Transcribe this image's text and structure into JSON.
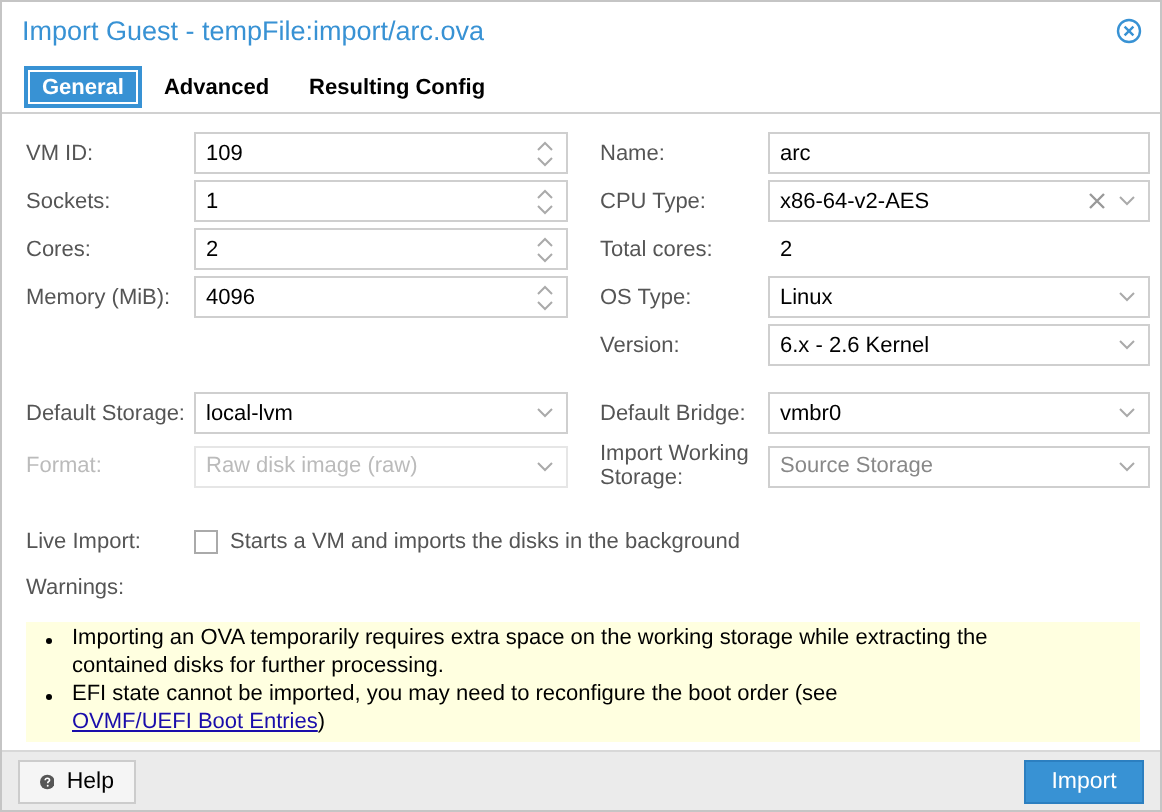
{
  "window": {
    "title": "Import Guest - tempFile:import/arc.ova"
  },
  "tabs": [
    {
      "label": "General",
      "selected": true
    },
    {
      "label": "Advanced",
      "selected": false
    },
    {
      "label": "Resulting Config",
      "selected": false
    }
  ],
  "top_left": [
    {
      "label": "VM ID:",
      "kind": "spinner",
      "value": "109",
      "disabled": false
    },
    {
      "label": "Sockets:",
      "kind": "spinner",
      "value": "1",
      "disabled": false
    },
    {
      "label": "Cores:",
      "kind": "spinner",
      "value": "2",
      "disabled": false
    },
    {
      "label": "Memory (MiB):",
      "kind": "spinner",
      "value": "4096",
      "disabled": false
    }
  ],
  "top_right": [
    {
      "label": "Name:",
      "kind": "text",
      "value": "arc",
      "disabled": false
    },
    {
      "label": "CPU Type:",
      "kind": "combo",
      "value": "x86-64-v2-AES",
      "clearable": true,
      "disabled": false
    },
    {
      "label": "Total cores:",
      "kind": "display",
      "value": "2"
    },
    {
      "label": "OS Type:",
      "kind": "combo",
      "value": "Linux",
      "disabled": false
    },
    {
      "label": "Version:",
      "kind": "combo",
      "value": "6.x - 2.6 Kernel",
      "disabled": false
    }
  ],
  "bottom_left": [
    {
      "label": "Default Storage:",
      "kind": "combo",
      "value": "local-lvm",
      "disabled": false
    },
    {
      "label": "Format:",
      "kind": "combo",
      "value": "Raw disk image (raw)",
      "disabled": true
    }
  ],
  "bottom_right": [
    {
      "label": "Default Bridge:",
      "kind": "combo",
      "value": "vmbr0",
      "disabled": false
    },
    {
      "label": "Import Working Storage:",
      "kind": "combo",
      "placeholder": "Source Storage",
      "disabled": false
    }
  ],
  "live_import": {
    "label": "Live Import:",
    "checked": false,
    "text": "Starts a VM and imports the disks in the background"
  },
  "warnings": {
    "label": "Warnings:",
    "items": [
      {
        "text": "Importing an OVA temporarily requires extra space on the working storage while extracting the contained disks for further processing."
      },
      {
        "text": "EFI state cannot be imported, you may need to reconfigure the boot order (see ",
        "link": "OVMF/UEFI Boot Entries",
        "after": ")"
      }
    ]
  },
  "buttons": {
    "help": "Help",
    "import": "Import"
  }
}
